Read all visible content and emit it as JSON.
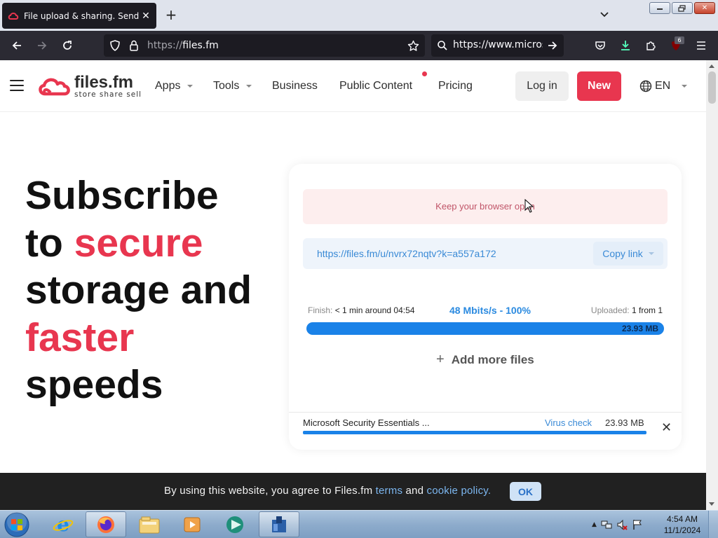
{
  "browser": {
    "tab_title": "File upload & sharing. Send large files",
    "url_scheme": "https://",
    "url_host": "files.fm",
    "search_value": "https://www.microsoft.com",
    "extension_badge": "6"
  },
  "header": {
    "logo_name": "files.fm",
    "logo_tagline": "store share sell",
    "nav": [
      "Apps",
      "Tools",
      "Business",
      "Public Content",
      "Pricing"
    ],
    "login": "Log in",
    "new": "New",
    "language": "EN"
  },
  "hero": {
    "line1": "Subscribe",
    "line2a": "to ",
    "line2b": "secure",
    "line3": "storage and",
    "line4": "faster",
    "line5": "speeds"
  },
  "upload": {
    "notice": "Keep your browser open",
    "share_link": "https://files.fm/u/nvrx72nqtv?k=a557a172",
    "copy_label": "Copy link",
    "finish_label": "Finish:",
    "finish_value": "< 1 min around 04:54",
    "speed": "48 Mbits/s - 100%",
    "uploaded_label": "Uploaded:",
    "uploaded_value": "1 from 1",
    "total_size": "23.93 MB",
    "progress": 1.0,
    "add_more": "Add more files",
    "file": {
      "name": "Microsoft Security Essentials ...",
      "virus_check": "Virus check",
      "size": "23.93 MB",
      "progress": 1.0
    }
  },
  "cookie": {
    "text_before": "By using this website, you agree to Files.fm ",
    "terms": "terms",
    "and": " and ",
    "policy": "cookie policy.",
    "ok": "OK"
  },
  "taskbar": {
    "time": "4:54 AM",
    "date": "11/1/2024"
  },
  "colors": {
    "brand_red": "#e8364f",
    "progress_blue": "#1a82e8",
    "link_blue": "#3a8ad6",
    "browser_dark": "#2b2a33"
  }
}
